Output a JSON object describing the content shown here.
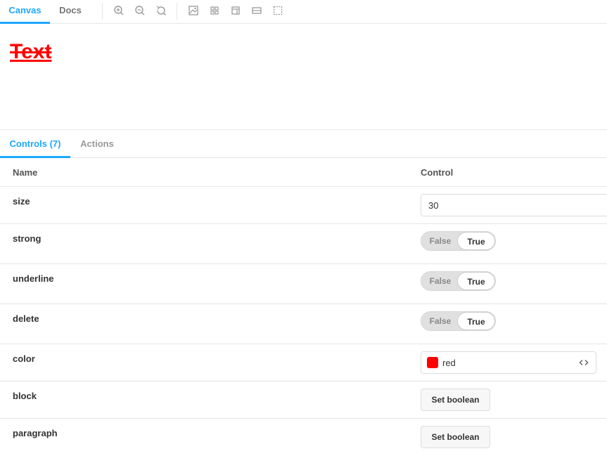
{
  "toolbar": {
    "tabs": [
      {
        "label": "Canvas",
        "active": true
      },
      {
        "label": "Docs",
        "active": false
      }
    ],
    "tools": [
      "zoom-in-icon",
      "zoom-out-icon",
      "zoom-reset-icon",
      "background-icon",
      "grid-icon",
      "viewport-icon",
      "measure-icon",
      "outline-icon"
    ]
  },
  "canvas": {
    "preview_text": "Text",
    "preview_color": "#ff0000"
  },
  "addons": {
    "tabs": [
      {
        "label": "Controls (7)",
        "active": true
      },
      {
        "label": "Actions",
        "active": false
      }
    ]
  },
  "controls": {
    "header": {
      "name": "Name",
      "control": "Control"
    },
    "rows": [
      {
        "name": "size",
        "type": "number",
        "value": "30"
      },
      {
        "name": "strong",
        "type": "boolean",
        "false_label": "False",
        "true_label": "True",
        "value": true
      },
      {
        "name": "underline",
        "type": "boolean",
        "false_label": "False",
        "true_label": "True",
        "value": true
      },
      {
        "name": "delete",
        "type": "boolean",
        "false_label": "False",
        "true_label": "True",
        "value": true
      },
      {
        "name": "color",
        "type": "color",
        "value": "red",
        "swatch": "#ff0000"
      },
      {
        "name": "block",
        "type": "unset-boolean",
        "button_label": "Set boolean"
      },
      {
        "name": "paragraph",
        "type": "unset-boolean",
        "button_label": "Set boolean"
      }
    ]
  },
  "colors": {
    "accent": "#1ea7fd",
    "border": "#e6e6e6"
  }
}
